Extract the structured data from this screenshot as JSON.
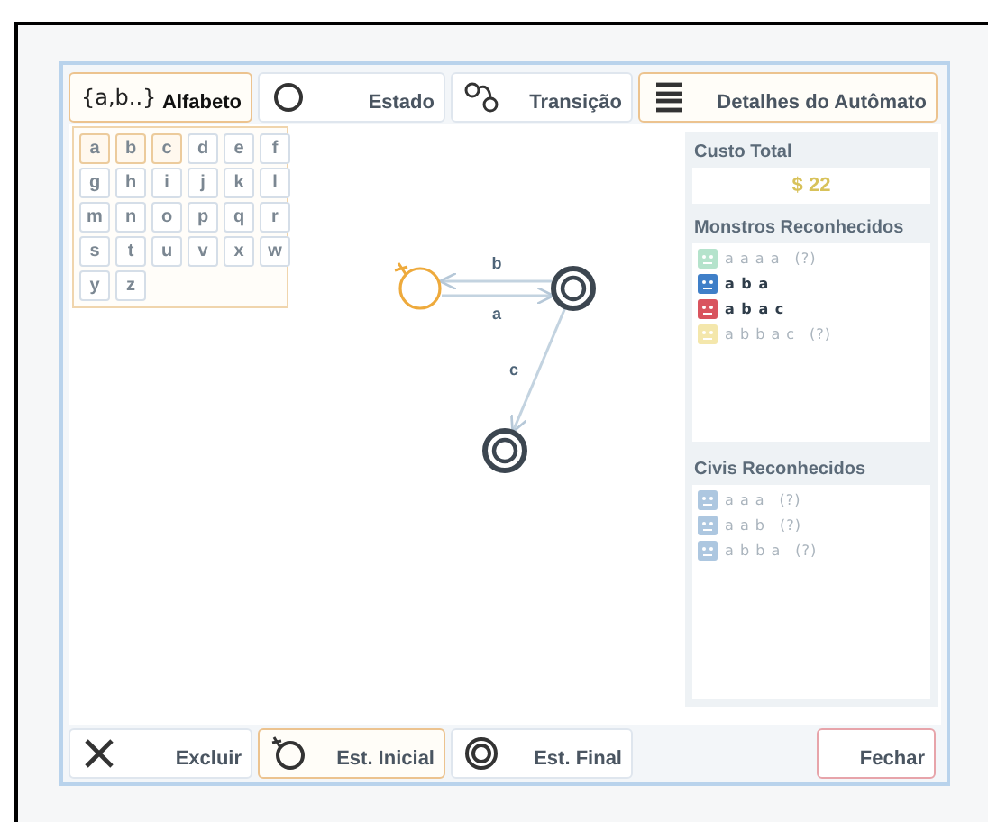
{
  "toolbar": [
    {
      "kind": "alphabet",
      "icon_text": "{a,b..}",
      "label": "Alfabeto",
      "selected": true
    },
    {
      "kind": "state",
      "label": "Estado",
      "selected": false
    },
    {
      "kind": "transition",
      "label": "Transição",
      "selected": false
    },
    {
      "kind": "details",
      "label": "Detalhes do Autômato",
      "selected": true
    }
  ],
  "alphabet": [
    {
      "letter": "a",
      "selected": true
    },
    {
      "letter": "b",
      "selected": true
    },
    {
      "letter": "c",
      "selected": true
    },
    {
      "letter": "d",
      "selected": false
    },
    {
      "letter": "e",
      "selected": false
    },
    {
      "letter": "f",
      "selected": false
    },
    {
      "letter": "g",
      "selected": false
    },
    {
      "letter": "h",
      "selected": false
    },
    {
      "letter": "i",
      "selected": false
    },
    {
      "letter": "j",
      "selected": false
    },
    {
      "letter": "k",
      "selected": false
    },
    {
      "letter": "l",
      "selected": false
    },
    {
      "letter": "m",
      "selected": false
    },
    {
      "letter": "n",
      "selected": false
    },
    {
      "letter": "o",
      "selected": false
    },
    {
      "letter": "p",
      "selected": false
    },
    {
      "letter": "q",
      "selected": false
    },
    {
      "letter": "r",
      "selected": false
    },
    {
      "letter": "s",
      "selected": false
    },
    {
      "letter": "t",
      "selected": false
    },
    {
      "letter": "u",
      "selected": false
    },
    {
      "letter": "v",
      "selected": false
    },
    {
      "letter": "x",
      "selected": false
    },
    {
      "letter": "w",
      "selected": false
    },
    {
      "letter": "y",
      "selected": false
    },
    {
      "letter": "z",
      "selected": false
    }
  ],
  "automaton": {
    "states": [
      {
        "initial": true,
        "final": false,
        "selected": true
      },
      {
        "initial": false,
        "final": true,
        "selected": false
      },
      {
        "initial": false,
        "final": true,
        "selected": false
      }
    ],
    "transitions": [
      {
        "label": "b"
      },
      {
        "label": "a"
      },
      {
        "label": "c"
      }
    ]
  },
  "details": {
    "cost_title": "Custo Total",
    "cost": "$ 22",
    "monsters_title": "Monstros Reconhecidos",
    "monsters": [
      {
        "word": "a a a a",
        "note": "(?)",
        "recognized": false,
        "color": "#b5e3cc"
      },
      {
        "word": "a b a",
        "recognized": true,
        "color": "#3f7fc8"
      },
      {
        "word": "a b a c",
        "recognized": true,
        "color": "#d9545e"
      },
      {
        "word": "a b b a c",
        "note": "(?)",
        "recognized": false,
        "color": "#f4e7ac"
      }
    ],
    "civilians_title": "Civis Reconhecidos",
    "civilians": [
      {
        "word": "a a a",
        "note": "(?)",
        "recognized": false,
        "color": "#adc7e0"
      },
      {
        "word": "a a b",
        "note": "(?)",
        "recognized": false,
        "color": "#adc7e0"
      },
      {
        "word": "a b b a",
        "note": "(?)",
        "recognized": false,
        "color": "#adc7e0"
      }
    ]
  },
  "bottom_bar": [
    {
      "kind": "delete",
      "label": "Excluir",
      "selected": false
    },
    {
      "kind": "initial",
      "label": "Est. Inicial",
      "selected": true
    },
    {
      "kind": "final",
      "label": "Est. Final",
      "selected": false
    }
  ],
  "close_button": {
    "label": "Fechar"
  }
}
